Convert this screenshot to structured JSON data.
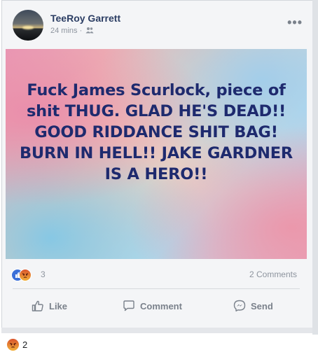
{
  "post": {
    "author_name": "TeeRoy Garrett",
    "timestamp": "24 mins",
    "separator": "·",
    "audience_icon": "friends-icon",
    "more_label": "•••",
    "banner_text": "Fuck James Scurlock, piece of shit THUG. GLAD HE'S DEAD!! GOOD RIDDANCE SHIT BAG! BURN IN HELL!! JAKE GARDNER IS A HERO!!",
    "reactions": {
      "icons": [
        "like-icon",
        "angry-icon"
      ],
      "count": "3"
    },
    "comments_count": "2 Comments",
    "actions": {
      "like": "Like",
      "comment": "Comment",
      "send": "Send"
    }
  },
  "footer": {
    "reaction_icon": "angry-icon",
    "reaction_count": "2"
  },
  "colors": {
    "author": "#2b3d63",
    "banner_text": "#1e2a6e",
    "meta": "#8d949e",
    "like_blue": "#3b6fd8",
    "angry_orange": "#d9532c"
  }
}
